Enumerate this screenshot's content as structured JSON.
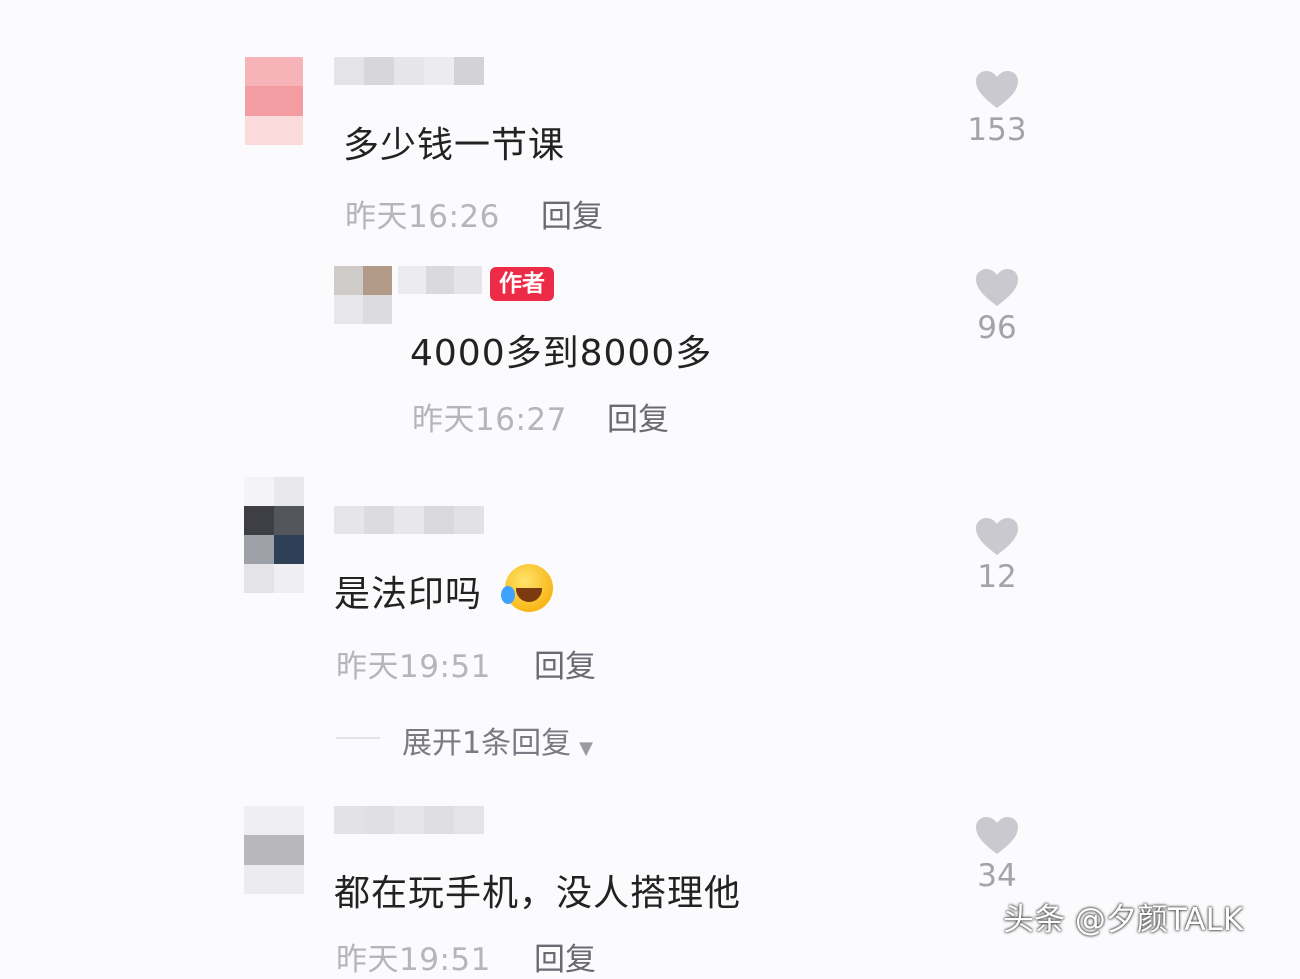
{
  "comments": [
    {
      "text": "多少钱一节课",
      "time": "昨天16:26",
      "reply_label": "回复",
      "likes": "153"
    },
    {
      "text": "4000多到8000多",
      "time": "昨天16:27",
      "reply_label": "回复",
      "likes": "96",
      "badge": "作者"
    },
    {
      "text": "是法印吗",
      "time": "昨天19:51",
      "reply_label": "回复",
      "likes": "12",
      "emoji": "rofl-emoji"
    },
    {
      "text": "都在玩手机，没人搭理他",
      "time": "昨天19:51",
      "reply_label": "回复",
      "likes": "34"
    }
  ],
  "expand_replies": "展开1条回复",
  "watermark": "头条 @夕颜TALK",
  "icons": {
    "like": "heart-icon",
    "expand": "caret-down-icon"
  },
  "colors": {
    "badge": "#ee2b47",
    "heart": "#c9c9cf"
  }
}
